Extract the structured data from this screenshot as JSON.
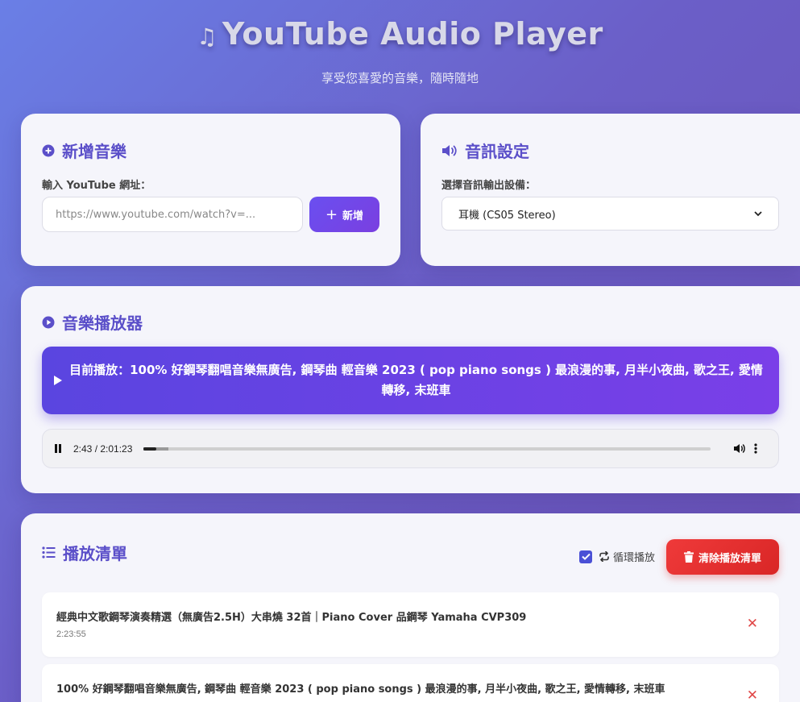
{
  "header": {
    "title": "YouTube Audio Player",
    "subtitle": "享受您喜愛的音樂，隨時隨地"
  },
  "add_music": {
    "title": "新增音樂",
    "url_label": "輸入 YouTube 網址：",
    "url_placeholder": "https://www.youtube.com/watch?v=...",
    "url_value": "",
    "add_button": "新增"
  },
  "audio_settings": {
    "title": "音訊設定",
    "device_label": "選擇音訊輸出設備：",
    "selected_device": "耳機 (CS05 Stereo)"
  },
  "player": {
    "title": "音樂播放器",
    "now_playing": "目前播放：100% 好鋼琴翻唱音樂無廣告, 鋼琴曲 輕音樂 2023 ( pop piano songs ) 最浪漫的事, 月半小夜曲, 歌之王, 愛情轉移, 末班車",
    "time_display": "2:43 / 2:01:23",
    "progress": 0.0224
  },
  "playlist": {
    "title": "播放清單",
    "loop_label": "循環播放",
    "loop_checked": true,
    "clear_button": "清除播放清單",
    "items": [
      {
        "title": "經典中文歌鋼琴演奏精選（無廣告2.5H）大串燒 32首｜Piano Cover 品鋼琴 Yamaha CVP309",
        "duration": "2:23:55"
      },
      {
        "title": "100% 好鋼琴翻唱音樂無廣告, 鋼琴曲 輕音樂 2023 ( pop piano songs ) 最浪漫的事, 月半小夜曲, 歌之王, 愛情轉移, 末班車",
        "duration": ""
      }
    ]
  },
  "colors": {
    "accent": "#5b4fc9",
    "danger": "#e53333",
    "background_start": "#6a7fe6",
    "background_end": "#6a4fb3"
  }
}
